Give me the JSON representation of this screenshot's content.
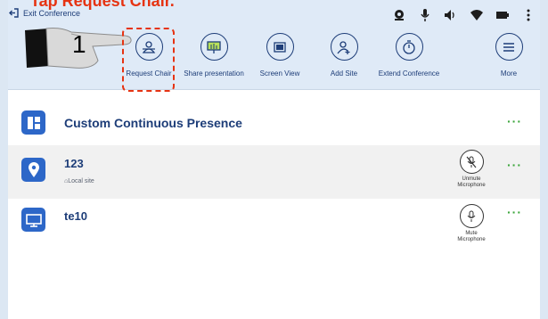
{
  "caption": "Tap Request Chair.",
  "step_number": "1",
  "header": {
    "exit_label": "Exit Conference",
    "system_icons": [
      "webcam-icon",
      "mic-icon",
      "speaker-icon",
      "wifi-icon",
      "battery-icon",
      "overflow-menu-icon"
    ]
  },
  "toolbar": {
    "items": [
      {
        "label": "Request Chair",
        "icon": "chair-icon"
      },
      {
        "label": "Share presentation",
        "icon": "presentation-icon"
      },
      {
        "label": "Screen View",
        "icon": "screen-view-icon"
      },
      {
        "label": "Add Site",
        "icon": "add-site-icon"
      },
      {
        "label": "Extend Conference",
        "icon": "timer-icon"
      },
      {
        "label": "More",
        "icon": "more-menu-icon"
      }
    ]
  },
  "list": {
    "items": [
      {
        "title": "Custom Continuous Presence",
        "subtitle": "",
        "icon": "layout-icon"
      },
      {
        "title": "123",
        "subtitle": "Local site",
        "icon": "location-pin-icon",
        "mic_label_line1": "Unmute",
        "mic_label_line2": "Microphone",
        "mic_state": "muted"
      },
      {
        "title": "te10",
        "subtitle": "",
        "icon": "monitor-icon",
        "mic_label_line1": "Mute",
        "mic_label_line2": "Microphone",
        "mic_state": "unmuted"
      }
    ],
    "more_label": "···"
  },
  "colors": {
    "toolbar_bg": "#dfeaf7",
    "accent": "#1d3d78",
    "icon_bg": "#2d67c8",
    "caption": "#e63312",
    "more_dots": "#3aa53a"
  }
}
